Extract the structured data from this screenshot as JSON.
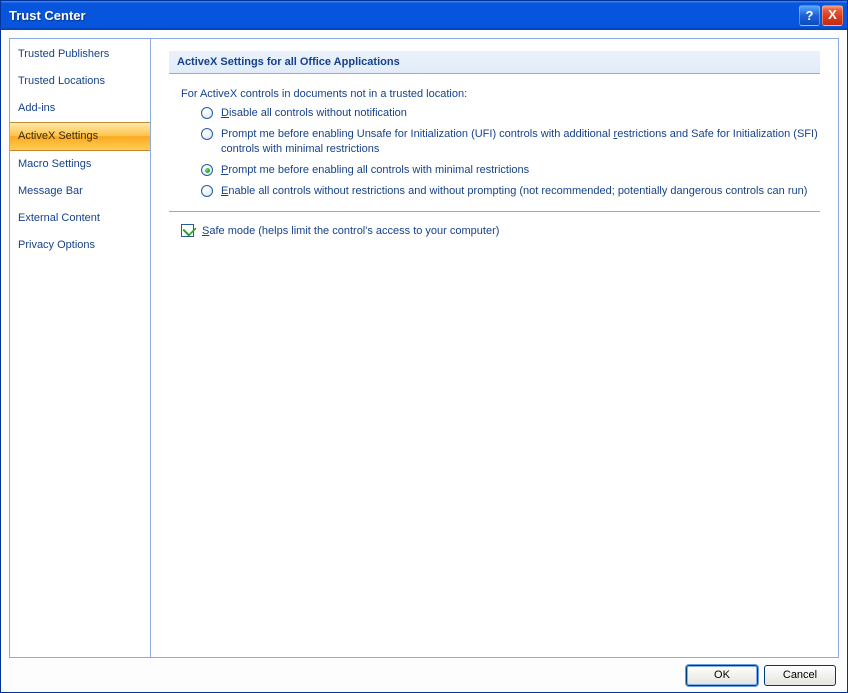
{
  "window": {
    "title": "Trust Center",
    "help_tooltip": "?",
    "close_tooltip": "X"
  },
  "sidebar": {
    "items": [
      {
        "label": "Trusted Publishers",
        "selected": false
      },
      {
        "label": "Trusted Locations",
        "selected": false
      },
      {
        "label": "Add-ins",
        "selected": false
      },
      {
        "label": "ActiveX Settings",
        "selected": true
      },
      {
        "label": "Macro Settings",
        "selected": false
      },
      {
        "label": "Message Bar",
        "selected": false
      },
      {
        "label": "External Content",
        "selected": false
      },
      {
        "label": "Privacy Options",
        "selected": false
      }
    ]
  },
  "content": {
    "section_header": "ActiveX Settings for all Office Applications",
    "intro": "For ActiveX controls in documents not in a trusted location:",
    "radios": [
      {
        "html": "<u>D</u>isable all controls without notification",
        "selected": false
      },
      {
        "html": "Prompt me before enabling Unsafe for Initialization (UFI) controls with additional <u>r</u>estrictions and Safe for Initialization (SFI) controls with minimal restrictions",
        "selected": false
      },
      {
        "html": "<u>P</u>rompt me before enabling all controls with minimal restrictions",
        "selected": true
      },
      {
        "html": "<u>E</u>nable all controls without restrictions and without prompting (not recommended; potentially dangerous controls can run)",
        "selected": false
      }
    ],
    "checkbox": {
      "html": "<u>S</u>afe mode (helps limit the control's access to your computer)",
      "checked": true
    }
  },
  "footer": {
    "ok_label": "OK",
    "cancel_label": "Cancel"
  }
}
